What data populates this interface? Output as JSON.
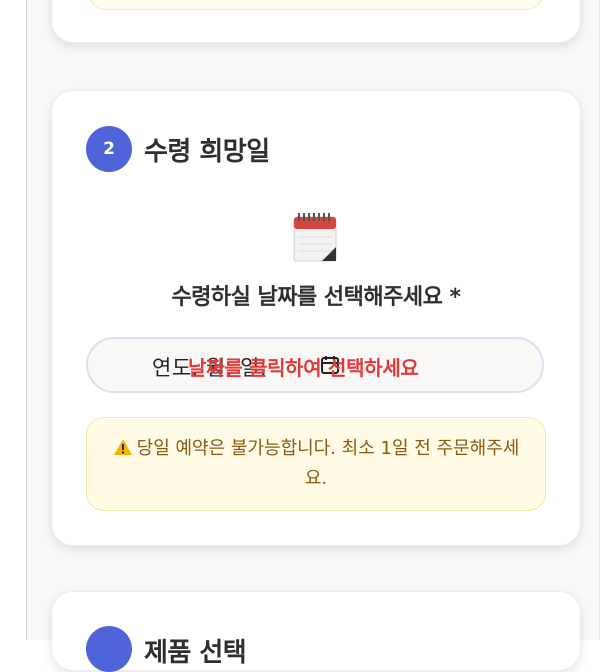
{
  "section2": {
    "step_number": "2",
    "title": "수령 희망일",
    "prompt": "수령하실 날짜를 선택해주세요 *",
    "date_input": {
      "placeholder": "연도. 월. 일.",
      "error": "날짜를 클릭하여 선택하세요"
    },
    "notice": {
      "icon": "warning-icon",
      "text": "당일 예약은 불가능합니다. 최소 1일 전 주문해주세요."
    }
  },
  "section3": {
    "title": "제품 선택"
  },
  "colors": {
    "accent": "#4f64d8",
    "error": "#e03a3a",
    "notice_bg": "#fffbe5",
    "notice_text": "#8a5a12"
  }
}
